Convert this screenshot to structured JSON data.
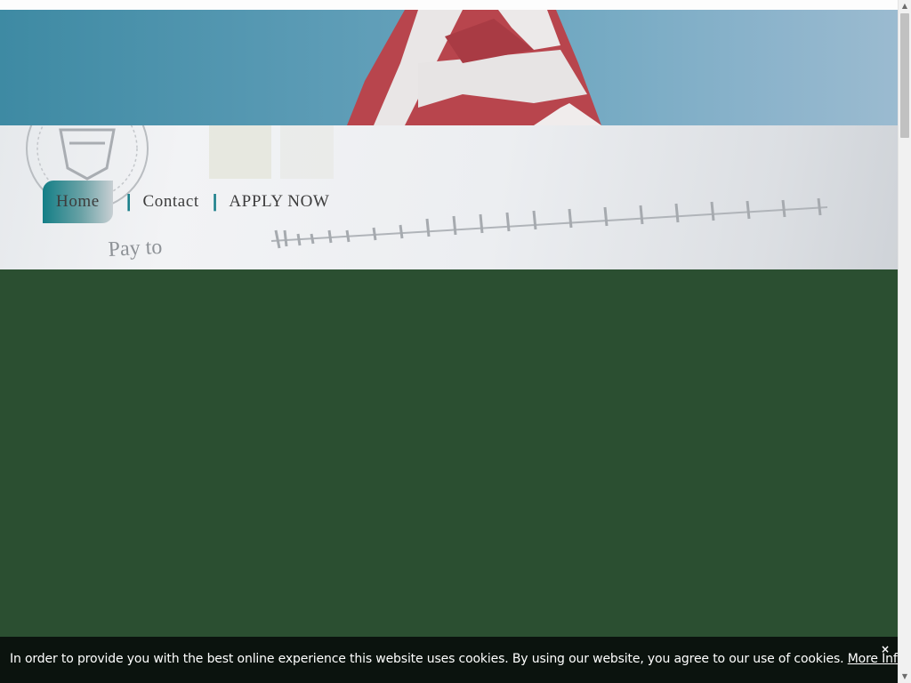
{
  "nav": {
    "home_label": "Home",
    "contact_label": "Contact",
    "apply_label": "APPLY NOW",
    "separator": "|"
  },
  "header": {
    "check_text": "Pay to"
  },
  "cookie": {
    "message": "In order to provide you with the best online experience this website uses cookies. By using our website, you agree to our use of cookies.",
    "more_info_label": "More Info",
    "trailing": ".",
    "close_symbol": "×"
  },
  "colors": {
    "main_background": "#2b4f31",
    "nav_accent": "#1b7f8a",
    "cookie_background": "#0b130e"
  },
  "icons": {
    "close": "close-icon",
    "scroll_up": "scroll-up-icon",
    "scroll_down": "scroll-down-icon"
  }
}
